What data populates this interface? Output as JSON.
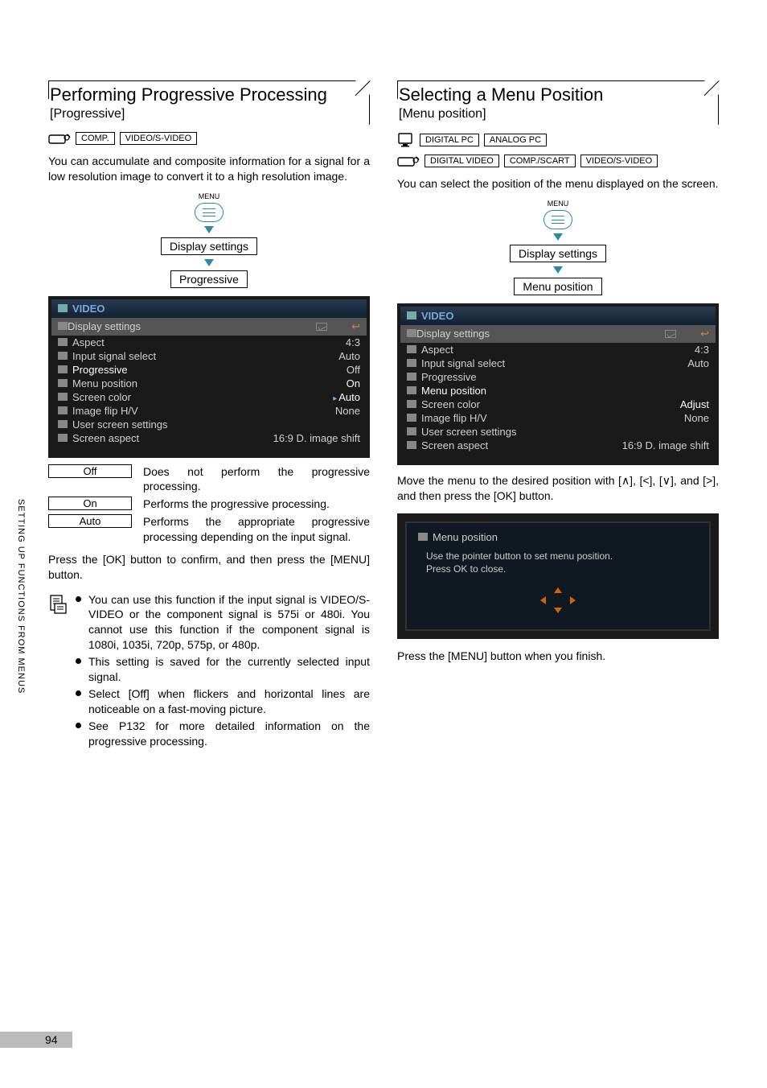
{
  "page_number": "94",
  "side_label": "SETTING UP FUNCTIONS FROM MENUS",
  "left": {
    "title": "Performing Progressive Processing",
    "subtitle": "[Progressive]",
    "tags": [
      "COMP.",
      "VIDEO/S-VIDEO"
    ],
    "intro": "You can accumulate and composite information for a signal for a low resolution image to convert it to a high resolution image.",
    "menu_label": "MENU",
    "flow": [
      "Display settings",
      "Progressive"
    ],
    "osd": {
      "header": "VIDEO",
      "section": "Display settings",
      "rows": [
        {
          "l": "Aspect",
          "r": "4:3"
        },
        {
          "l": "Input signal select",
          "r": "Auto"
        },
        {
          "l": "Progressive",
          "r": "Off",
          "hl_l": true
        },
        {
          "l": "Menu position",
          "r": "On",
          "hl_r": true
        },
        {
          "l": "Screen color",
          "r": "Auto",
          "caret": true,
          "hl_r": true
        },
        {
          "l": "Image flip H/V",
          "r": "None"
        },
        {
          "l": "User screen settings",
          "r": ""
        },
        {
          "l": "Screen aspect",
          "r": "16:9 D. image shift"
        }
      ]
    },
    "options": [
      {
        "label": "Off",
        "desc": "Does not perform the progressive processing."
      },
      {
        "label": "On",
        "desc": "Performs the progressive processing."
      },
      {
        "label": "Auto",
        "desc": "Performs the appropriate progressive processing depending on the input signal."
      }
    ],
    "confirm": "Press the [OK] button to confirm, and then press the [MENU] button.",
    "notes": [
      "You can use this function if the input signal is VIDEO/S-VIDEO or the component signal is 575i or 480i. You cannot use this function if the component signal is 1080i, 1035i, 720p, 575p, or 480p.",
      "This setting is saved for the currently selected input signal.",
      "Select [Off] when flickers and horizontal lines are noticeable on a fast-moving picture.",
      "See P132 for more detailed information on the progressive processing."
    ]
  },
  "right": {
    "title": "Selecting a Menu Position",
    "subtitle": "[Menu position]",
    "tags_top": [
      "DIGITAL PC",
      "ANALOG PC"
    ],
    "tags_bot": [
      "DIGITAL VIDEO",
      "COMP./SCART",
      "VIDEO/S-VIDEO"
    ],
    "intro": "You can select the position of the menu displayed on the screen.",
    "menu_label": "MENU",
    "flow": [
      "Display settings",
      "Menu position"
    ],
    "osd": {
      "header": "VIDEO",
      "section": "Display settings",
      "rows": [
        {
          "l": "Aspect",
          "r": "4:3"
        },
        {
          "l": "Input signal select",
          "r": "Auto"
        },
        {
          "l": "Progressive",
          "r": ""
        },
        {
          "l": "Menu position",
          "r": "",
          "hl_l": true
        },
        {
          "l": "Screen color",
          "r": "Adjust",
          "hl_r": true
        },
        {
          "l": "Image flip H/V",
          "r": "None"
        },
        {
          "l": "User screen settings",
          "r": ""
        },
        {
          "l": "Screen aspect",
          "r": "16:9 D. image shift"
        }
      ]
    },
    "move_text": "Move the menu to the desired position with [∧], [<], [∨], and [>], and then press the [OK] button.",
    "adjust_title": "Menu position",
    "adjust_body1": "Use the pointer button to set menu position.",
    "adjust_body2": "Press OK to close.",
    "finish": "Press the [MENU] button when you finish."
  }
}
